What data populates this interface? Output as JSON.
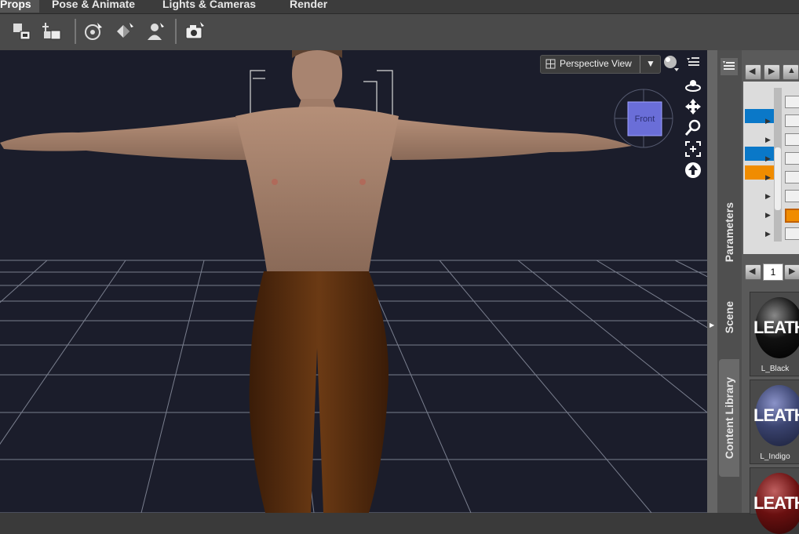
{
  "tabs": [
    {
      "label": "Props",
      "active": true
    },
    {
      "label": "Pose & Animate",
      "active": false
    },
    {
      "label": "Lights & Cameras",
      "active": false
    },
    {
      "label": "Render",
      "active": false
    }
  ],
  "viewport": {
    "view_label": "Perspective View",
    "cube_label": "Front"
  },
  "panel": {
    "vertical_tabs": [
      "Parameters",
      "Scene",
      "Content Library"
    ],
    "page_number": "1",
    "materials": [
      {
        "label": "L_Black",
        "text": "LEATH",
        "color": "#111111"
      },
      {
        "label": "L_Indigo",
        "text": "LEATH",
        "color": "#3b4470"
      },
      {
        "label": "",
        "text": "LEATH",
        "color": "#6a1010"
      }
    ]
  },
  "colors": {
    "accent_blue": "#0a78c8",
    "accent_orange": "#f08c00",
    "viewport_bg": "#1b1d2b"
  }
}
